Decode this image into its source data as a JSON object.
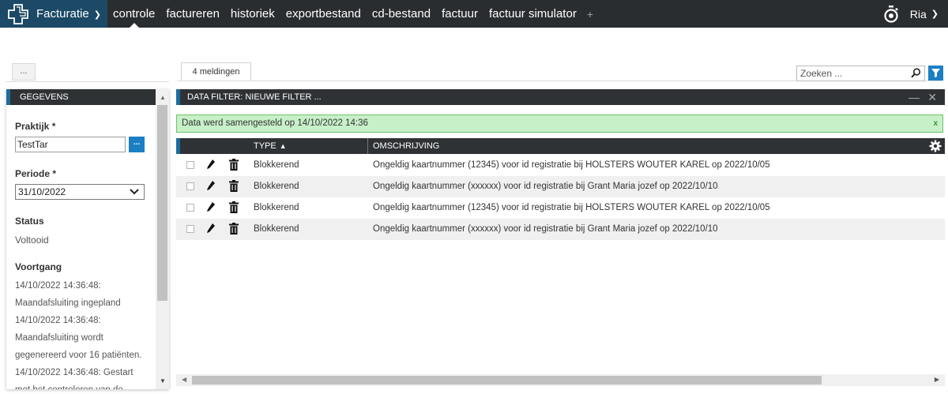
{
  "topnav": {
    "app_name": "Facturatie",
    "items": [
      {
        "label": "controle",
        "active": true
      },
      {
        "label": "factureren",
        "active": false
      },
      {
        "label": "historiek",
        "active": false
      },
      {
        "label": "exportbestand",
        "active": false
      },
      {
        "label": "cd-bestand",
        "active": false
      },
      {
        "label": "factuur",
        "active": false
      },
      {
        "label": "factuur simulator",
        "active": false
      }
    ],
    "plus": "+",
    "user": "Ria"
  },
  "left": {
    "dots_label": "...",
    "header": "GEGEVENS",
    "praktijk_label": "Praktijk *",
    "praktijk_value": "TestTar",
    "lookup_label": "...",
    "periode_label": "Periode *",
    "periode_value": "31/10/2022",
    "status_label": "Status",
    "status_value": "Voltooid",
    "voortgang_label": "Voortgang",
    "log": [
      "14/10/2022 14:36:48:",
      "Maandafsluiting ingepland",
      "14/10/2022 14:36:48:",
      "Maandafsluiting wordt",
      "gegenereerd voor 16 patiënten.",
      "14/10/2022 14:36:48: Gestart",
      "met het controleren van de"
    ]
  },
  "main": {
    "tab_label": "4 meldingen",
    "search_placeholder": "Zoeken ...",
    "filter_bar_title": "DATA FILTER: NIEUWE FILTER ...",
    "notice_text": "Data werd samengesteld op 14/10/2022 14:36",
    "notice_close": "x",
    "columns": {
      "type": "TYPE",
      "description": "OMSCHRIJVING"
    },
    "rows": [
      {
        "type": "Blokkerend",
        "description": "Ongeldig kaartnummer (12345) voor id registratie bij HOLSTERS WOUTER KAREL op 2022/10/05"
      },
      {
        "type": "Blokkerend",
        "description": "Ongeldig kaartnummer (xxxxxx) voor id registratie bij Grant Maria jozef op 2022/10/10"
      },
      {
        "type": "Blokkerend",
        "description": "Ongeldig kaartnummer (12345) voor id registratie bij HOLSTERS WOUTER KAREL op 2022/10/05"
      },
      {
        "type": "Blokkerend",
        "description": "Ongeldig kaartnummer (xxxxxx) voor id registratie bij Grant Maria jozef op 2022/10/10"
      }
    ]
  },
  "colors": {
    "nav_bg": "#2a2d30",
    "brand_bg": "#1b4966",
    "accent": "#1b7fc4",
    "notice_bg": "#c8f0c8"
  }
}
